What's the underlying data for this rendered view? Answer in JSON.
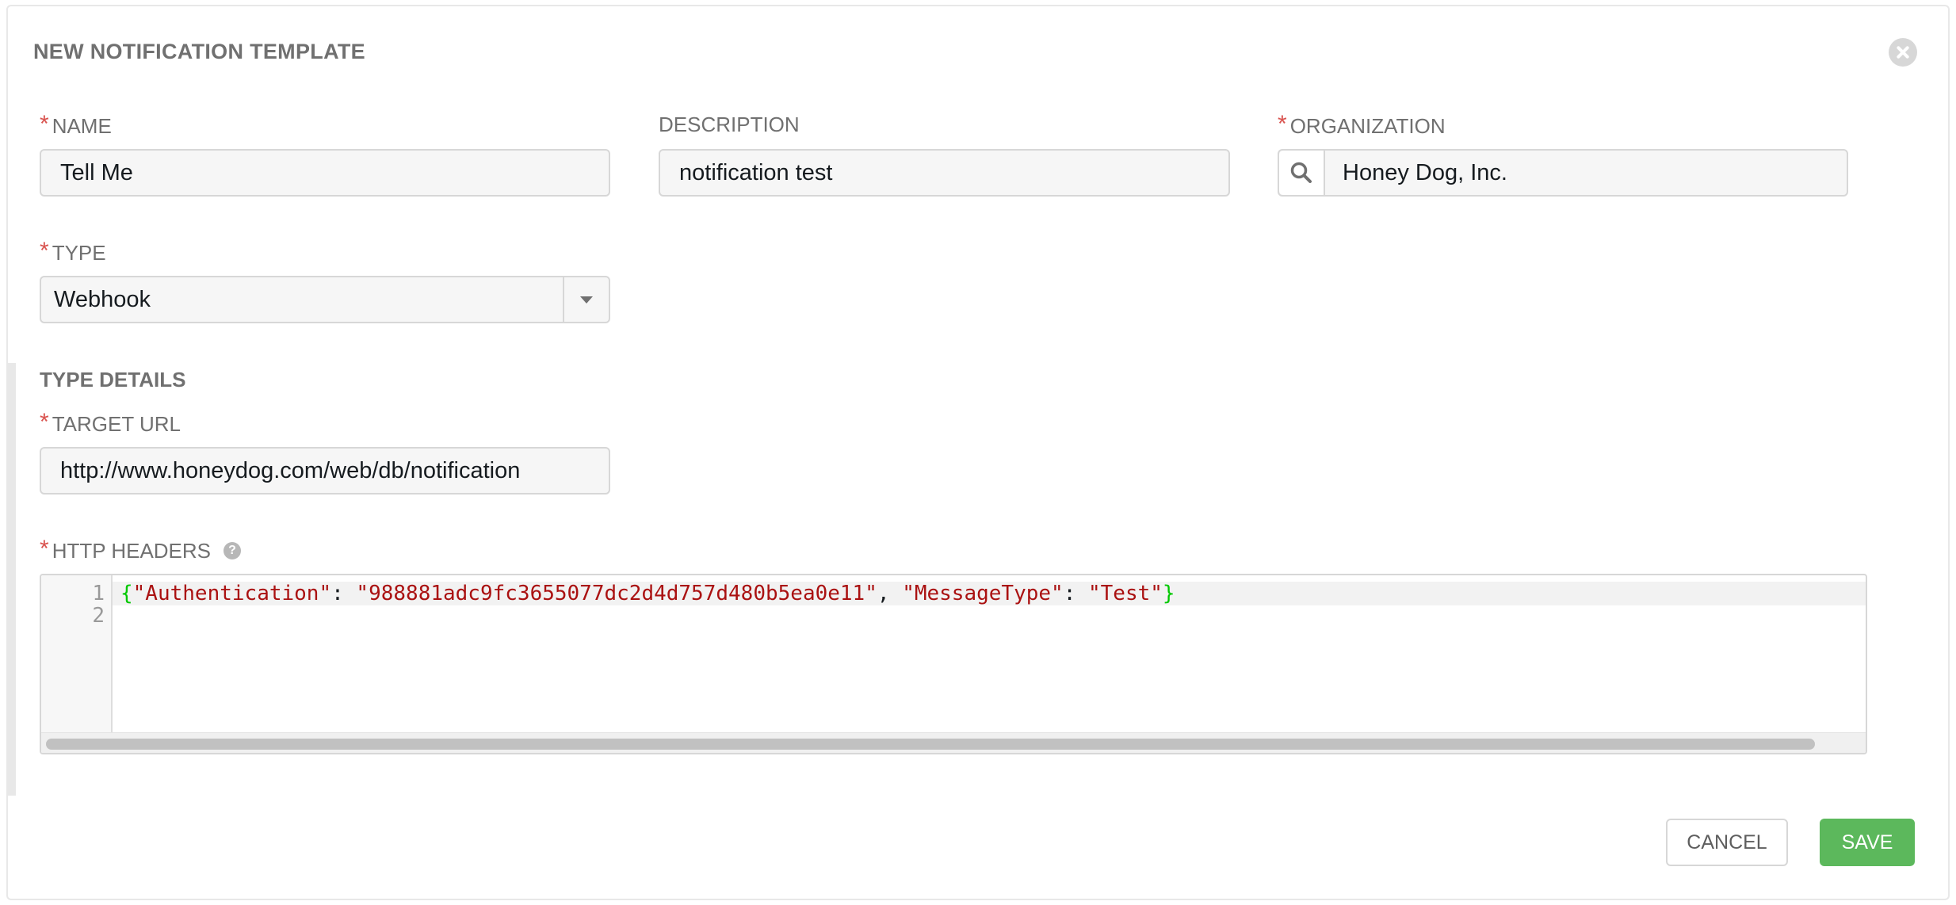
{
  "dialog": {
    "title": "NEW NOTIFICATION TEMPLATE"
  },
  "fields": {
    "name": {
      "label": "NAME",
      "value": "Tell Me"
    },
    "description": {
      "label": "DESCRIPTION",
      "value": "notification test"
    },
    "organization": {
      "label": "ORGANIZATION",
      "value": "Honey Dog, Inc."
    },
    "type": {
      "label": "TYPE",
      "value": "Webhook"
    }
  },
  "type_details": {
    "title": "TYPE DETAILS",
    "target_url": {
      "label": "TARGET URL",
      "value": "http://www.honeydog.com/web/db/notification"
    },
    "http_headers": {
      "label": "HTTP HEADERS",
      "help": "?",
      "line_numbers": [
        "1",
        "2"
      ],
      "code": {
        "open_brace": "{",
        "key1": "\"Authentication\"",
        "sep1": ": ",
        "val1": "\"988881adc9fc3655077dc2d4d757d480b5ea0e11\"",
        "comma": ", ",
        "key2": "\"MessageType\"",
        "sep2": ": ",
        "val2": "\"Test\"",
        "close_brace": "}"
      }
    }
  },
  "required_marker": "*",
  "buttons": {
    "cancel": "CANCEL",
    "save": "SAVE"
  },
  "icons": {
    "close": "close-icon",
    "search": "search-icon",
    "dropdown": "chevron-down-icon",
    "help": "help-icon"
  },
  "colors": {
    "required": "#d9534f",
    "save": "#5cb85c",
    "json_brace": "#00c800",
    "json_string": "#aa1111"
  }
}
